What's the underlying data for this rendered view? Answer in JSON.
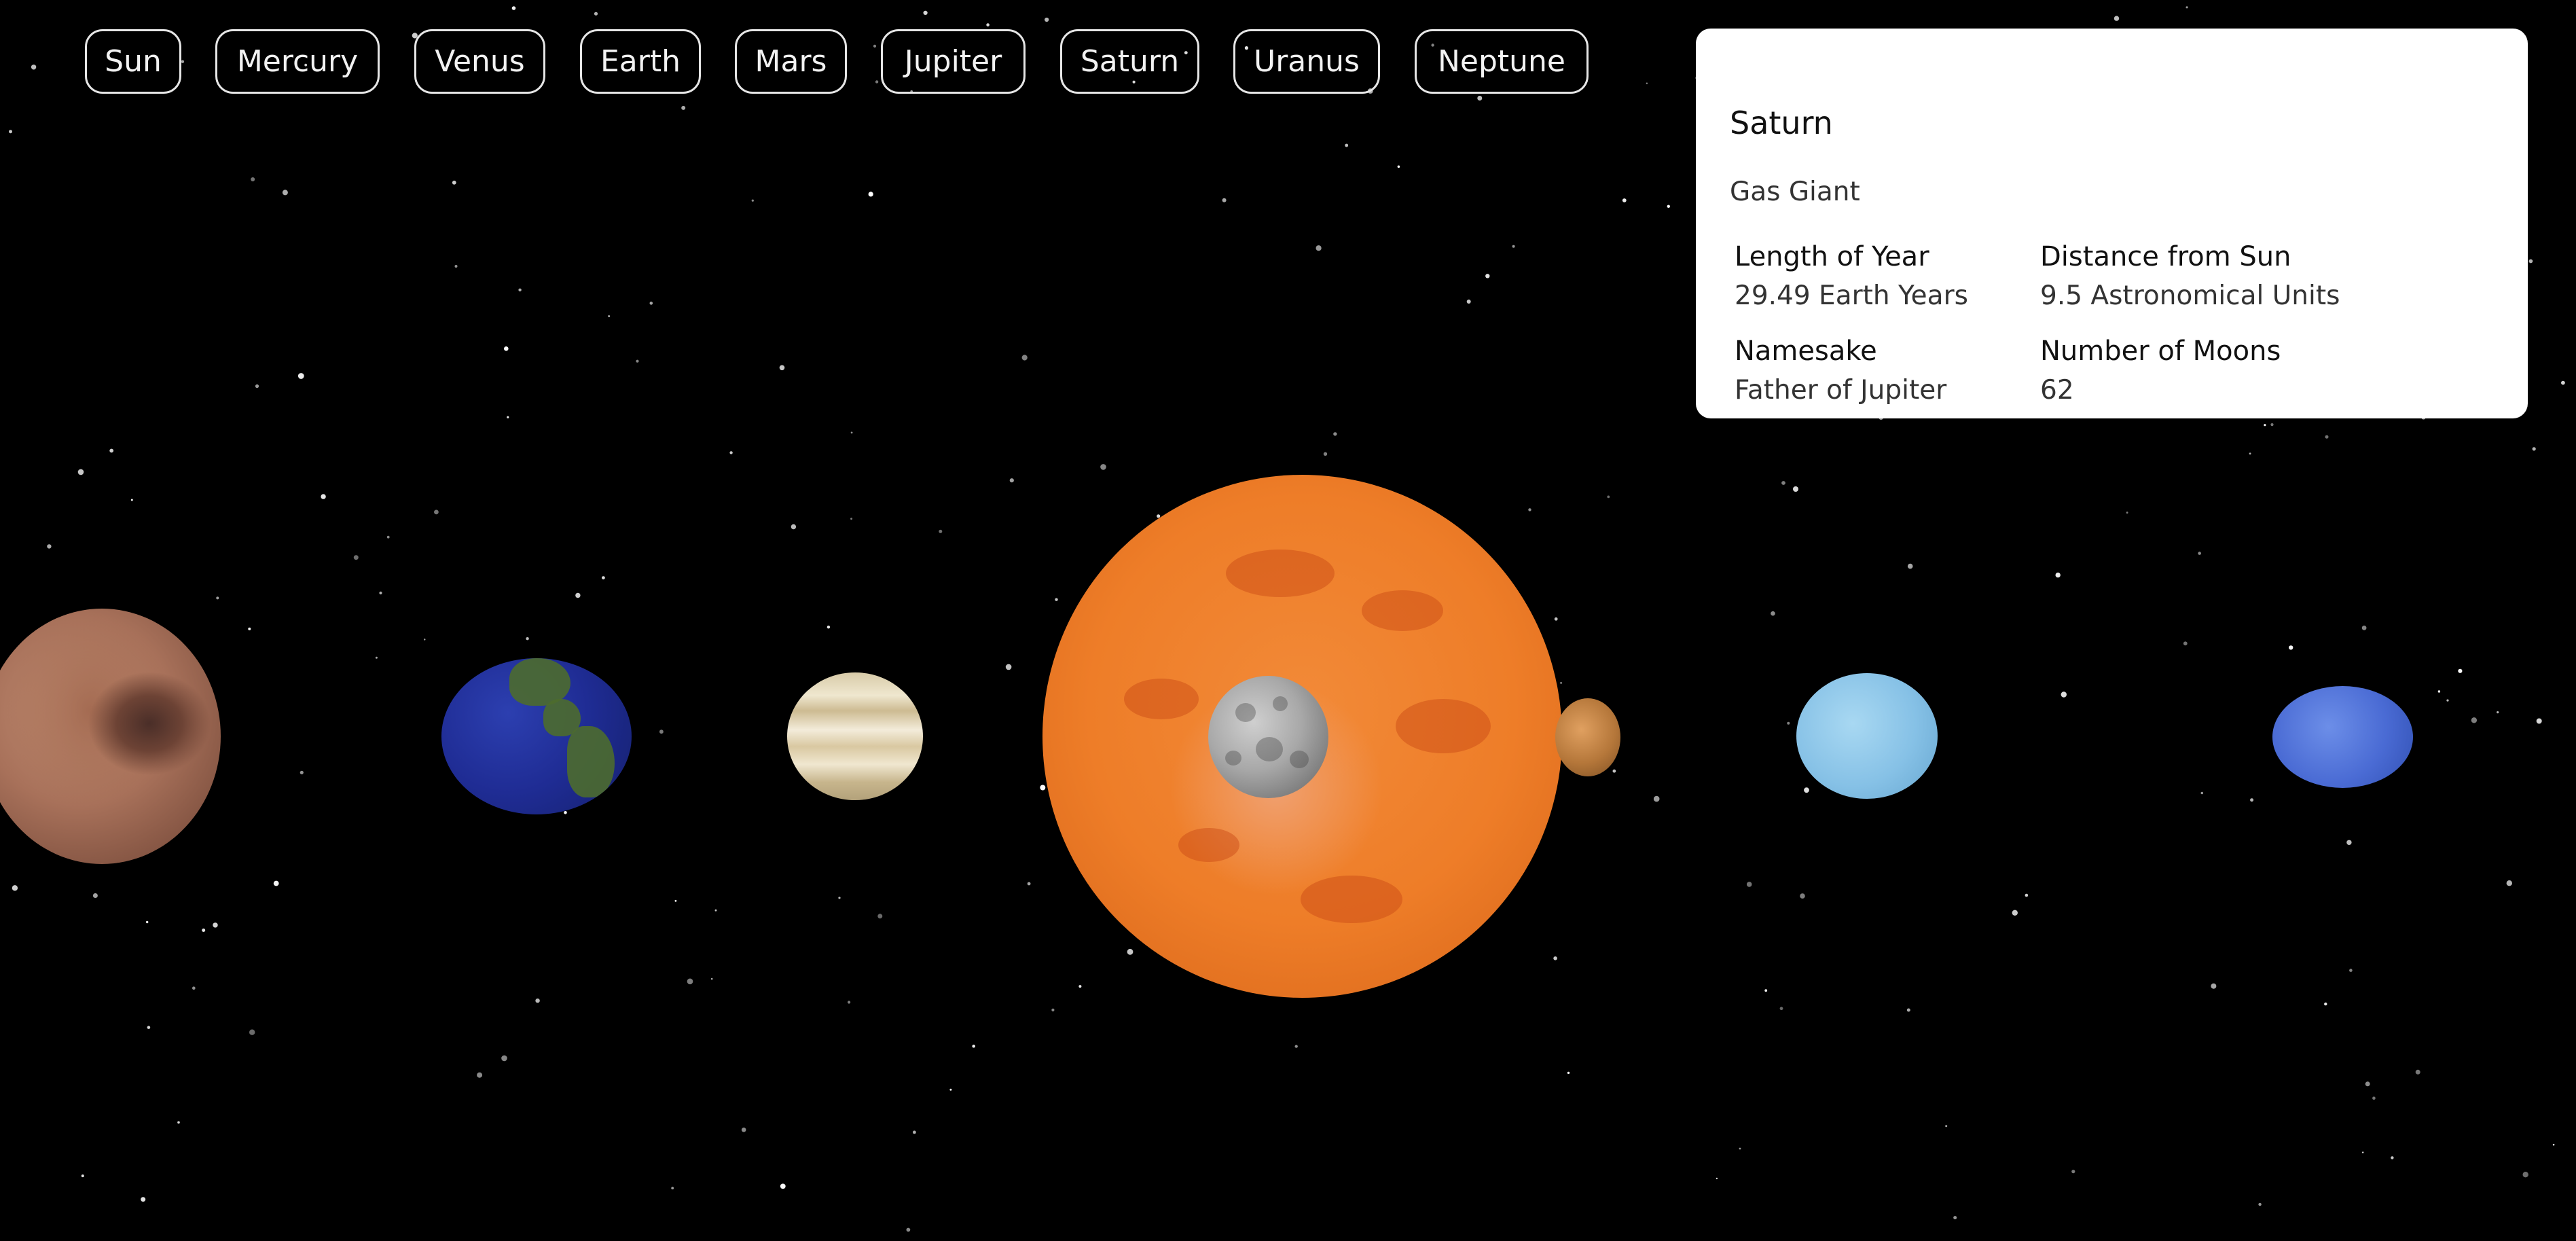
{
  "nav": {
    "items": [
      {
        "label": "Sun"
      },
      {
        "label": "Mercury"
      },
      {
        "label": "Venus"
      },
      {
        "label": "Earth"
      },
      {
        "label": "Mars"
      },
      {
        "label": "Jupiter"
      },
      {
        "label": "Saturn"
      },
      {
        "label": "Uranus"
      },
      {
        "label": "Neptune"
      }
    ]
  },
  "info": {
    "title": "Saturn",
    "subtitle": "Gas Giant",
    "facts": [
      {
        "label": "Length of Year",
        "value": "29.49 Earth Years"
      },
      {
        "label": "Distance from Sun",
        "value": "9.5 Astronomical Units"
      },
      {
        "label": "Namesake",
        "value": "Father of Jupiter"
      },
      {
        "label": "Number of Moons",
        "value": "62"
      }
    ]
  },
  "colors": {
    "background": "#000000",
    "card_background": "#ffffff",
    "nav_text": "#f2f2f2",
    "nav_border": "#e6e6e6"
  }
}
